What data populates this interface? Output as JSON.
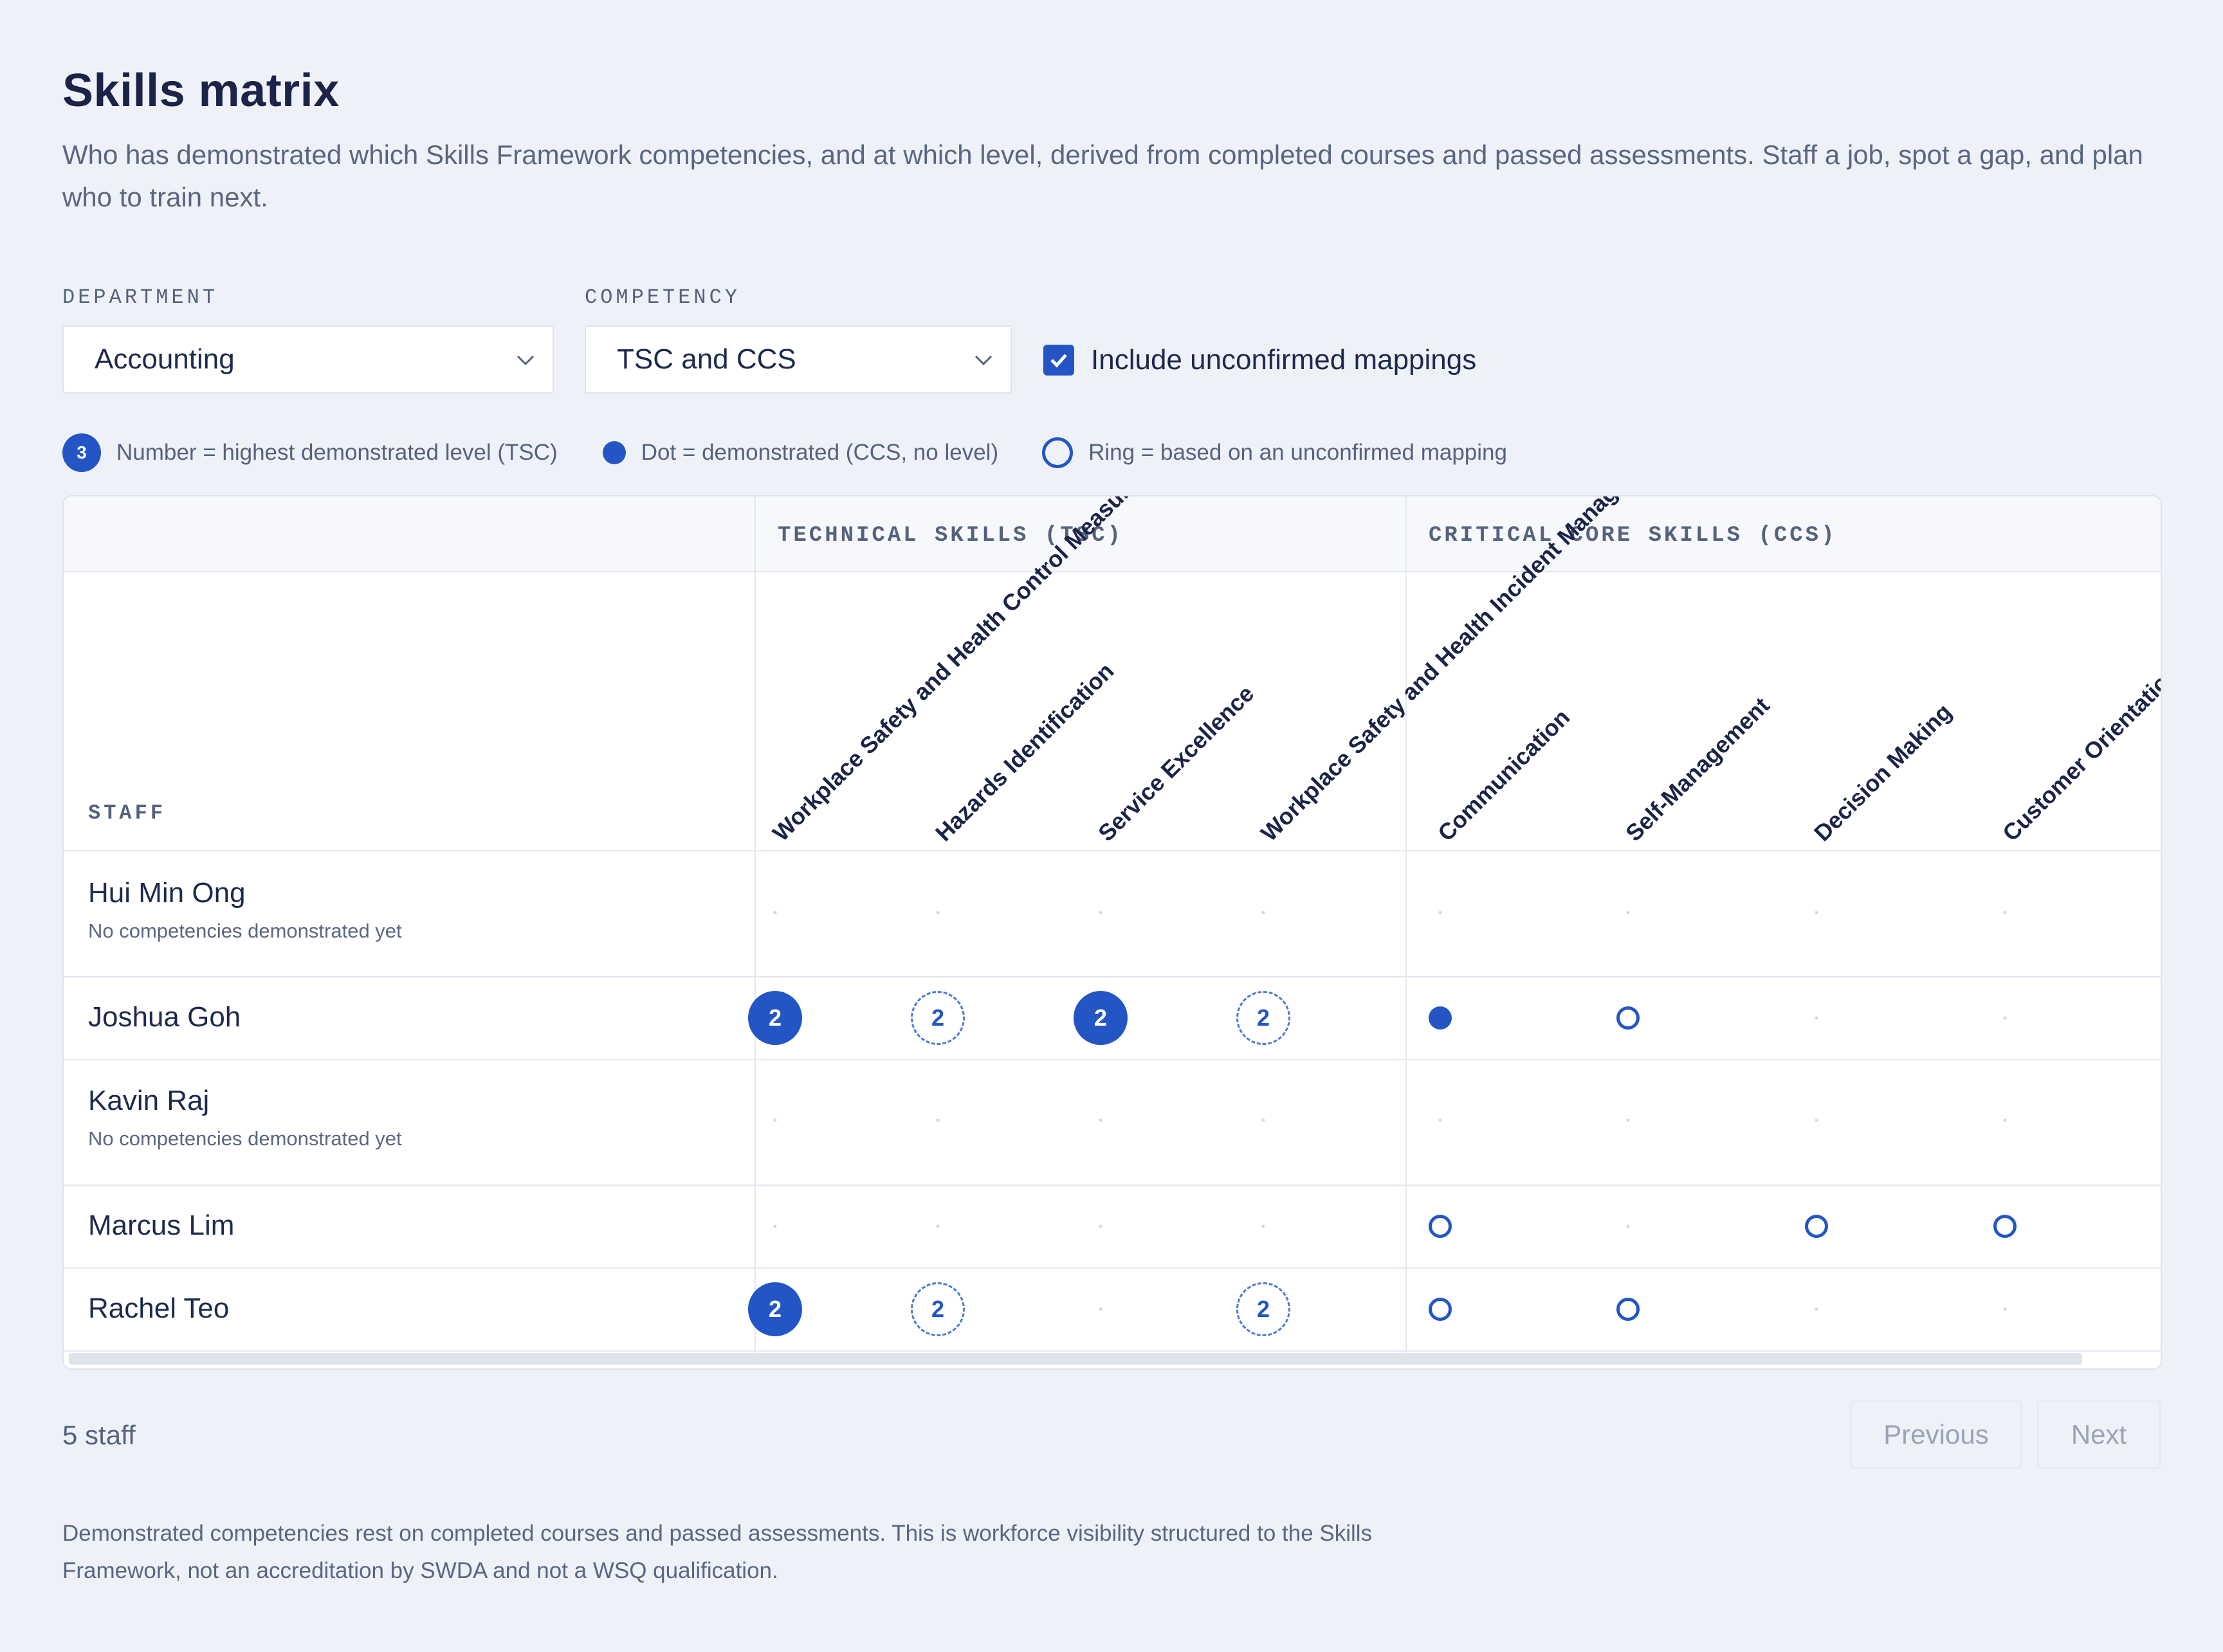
{
  "page": {
    "title": "Skills matrix",
    "description": "Who has demonstrated which Skills Framework competencies, and at which level, derived from completed courses and passed assessments. Staff a job, spot a gap, and plan who to train next."
  },
  "filters": {
    "department_label": "DEPARTMENT",
    "department_value": "Accounting",
    "competency_label": "COMPETENCY",
    "competency_value": "TSC and CCS",
    "include_unconfirmed_label": "Include unconfirmed mappings",
    "include_unconfirmed_checked": true
  },
  "legend": {
    "number_sample": "3",
    "number_text": "Number = highest demonstrated level (TSC)",
    "dot_text": "Dot = demonstrated (CCS, no level)",
    "ring_text": "Ring = based on an unconfirmed mapping"
  },
  "matrix": {
    "staff_header": "STAFF",
    "tsc_group": "TECHNICAL SKILLS (TSC)",
    "ccs_group": "CRITICAL CORE SKILLS (CCS)",
    "competencies": [
      "Workplace Safety and Health Control Measures",
      "Hazards Identification",
      "Service Excellence",
      "Workplace Safety and Health Incident Management",
      "Communication",
      "Self-Management",
      "Decision Making",
      "Customer Orientation"
    ],
    "rows": [
      {
        "name": "Hui Min Ong",
        "sub": "No competencies demonstrated yet",
        "cells": [
          [
            "empty",
            ""
          ],
          [
            "empty",
            ""
          ],
          [
            "empty",
            ""
          ],
          [
            "empty",
            ""
          ],
          [
            "empty",
            ""
          ],
          [
            "empty",
            ""
          ],
          [
            "empty",
            ""
          ],
          [
            "empty",
            ""
          ]
        ]
      },
      {
        "name": "Joshua Goh",
        "sub": "",
        "cells": [
          [
            "filled",
            "2"
          ],
          [
            "dashed",
            "2"
          ],
          [
            "filled",
            "2"
          ],
          [
            "dashed",
            "2"
          ],
          [
            "dot",
            ""
          ],
          [
            "ring",
            ""
          ],
          [
            "empty",
            ""
          ],
          [
            "empty",
            ""
          ]
        ]
      },
      {
        "name": "Kavin Raj",
        "sub": "No competencies demonstrated yet",
        "cells": [
          [
            "empty",
            ""
          ],
          [
            "empty",
            ""
          ],
          [
            "empty",
            ""
          ],
          [
            "empty",
            ""
          ],
          [
            "empty",
            ""
          ],
          [
            "empty",
            ""
          ],
          [
            "empty",
            ""
          ],
          [
            "empty",
            ""
          ]
        ]
      },
      {
        "name": "Marcus Lim",
        "sub": "",
        "cells": [
          [
            "empty",
            ""
          ],
          [
            "empty",
            ""
          ],
          [
            "empty",
            ""
          ],
          [
            "empty",
            ""
          ],
          [
            "ring",
            ""
          ],
          [
            "empty",
            ""
          ],
          [
            "ring",
            ""
          ],
          [
            "ring",
            ""
          ]
        ]
      },
      {
        "name": "Rachel Teo",
        "sub": "",
        "cells": [
          [
            "filled",
            "2"
          ],
          [
            "dashed",
            "2"
          ],
          [
            "empty",
            ""
          ],
          [
            "dashed",
            "2"
          ],
          [
            "ring",
            ""
          ],
          [
            "ring",
            ""
          ],
          [
            "empty",
            ""
          ],
          [
            "empty",
            ""
          ]
        ]
      }
    ]
  },
  "footer": {
    "count": "5 staff",
    "previous": "Previous",
    "next": "Next",
    "note": "Demonstrated competencies rest on completed courses and passed assessments. This is workforce visibility structured to the Skills Framework, not an accreditation by SWDA and not a WSQ qualification."
  }
}
